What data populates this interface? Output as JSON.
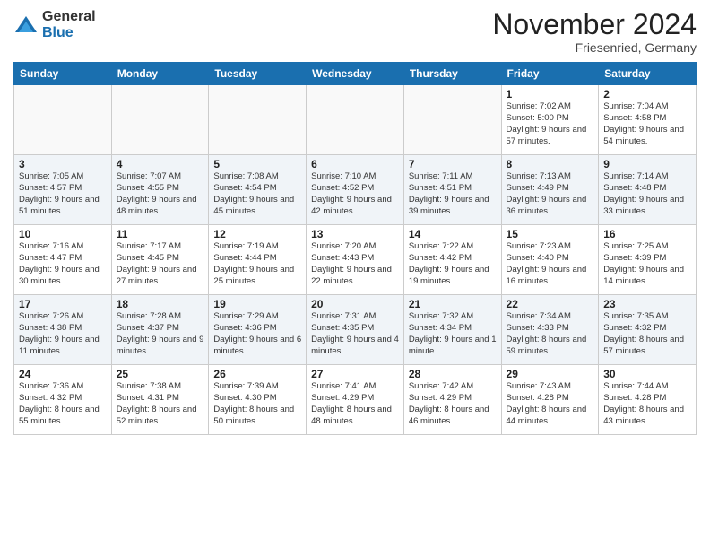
{
  "logo": {
    "general": "General",
    "blue": "Blue"
  },
  "title": "November 2024",
  "location": "Friesenried, Germany",
  "days_of_week": [
    "Sunday",
    "Monday",
    "Tuesday",
    "Wednesday",
    "Thursday",
    "Friday",
    "Saturday"
  ],
  "weeks": [
    [
      {
        "day": "",
        "info": ""
      },
      {
        "day": "",
        "info": ""
      },
      {
        "day": "",
        "info": ""
      },
      {
        "day": "",
        "info": ""
      },
      {
        "day": "",
        "info": ""
      },
      {
        "day": "1",
        "info": "Sunrise: 7:02 AM\nSunset: 5:00 PM\nDaylight: 9 hours and 57 minutes."
      },
      {
        "day": "2",
        "info": "Sunrise: 7:04 AM\nSunset: 4:58 PM\nDaylight: 9 hours and 54 minutes."
      }
    ],
    [
      {
        "day": "3",
        "info": "Sunrise: 7:05 AM\nSunset: 4:57 PM\nDaylight: 9 hours and 51 minutes."
      },
      {
        "day": "4",
        "info": "Sunrise: 7:07 AM\nSunset: 4:55 PM\nDaylight: 9 hours and 48 minutes."
      },
      {
        "day": "5",
        "info": "Sunrise: 7:08 AM\nSunset: 4:54 PM\nDaylight: 9 hours and 45 minutes."
      },
      {
        "day": "6",
        "info": "Sunrise: 7:10 AM\nSunset: 4:52 PM\nDaylight: 9 hours and 42 minutes."
      },
      {
        "day": "7",
        "info": "Sunrise: 7:11 AM\nSunset: 4:51 PM\nDaylight: 9 hours and 39 minutes."
      },
      {
        "day": "8",
        "info": "Sunrise: 7:13 AM\nSunset: 4:49 PM\nDaylight: 9 hours and 36 minutes."
      },
      {
        "day": "9",
        "info": "Sunrise: 7:14 AM\nSunset: 4:48 PM\nDaylight: 9 hours and 33 minutes."
      }
    ],
    [
      {
        "day": "10",
        "info": "Sunrise: 7:16 AM\nSunset: 4:47 PM\nDaylight: 9 hours and 30 minutes."
      },
      {
        "day": "11",
        "info": "Sunrise: 7:17 AM\nSunset: 4:45 PM\nDaylight: 9 hours and 27 minutes."
      },
      {
        "day": "12",
        "info": "Sunrise: 7:19 AM\nSunset: 4:44 PM\nDaylight: 9 hours and 25 minutes."
      },
      {
        "day": "13",
        "info": "Sunrise: 7:20 AM\nSunset: 4:43 PM\nDaylight: 9 hours and 22 minutes."
      },
      {
        "day": "14",
        "info": "Sunrise: 7:22 AM\nSunset: 4:42 PM\nDaylight: 9 hours and 19 minutes."
      },
      {
        "day": "15",
        "info": "Sunrise: 7:23 AM\nSunset: 4:40 PM\nDaylight: 9 hours and 16 minutes."
      },
      {
        "day": "16",
        "info": "Sunrise: 7:25 AM\nSunset: 4:39 PM\nDaylight: 9 hours and 14 minutes."
      }
    ],
    [
      {
        "day": "17",
        "info": "Sunrise: 7:26 AM\nSunset: 4:38 PM\nDaylight: 9 hours and 11 minutes."
      },
      {
        "day": "18",
        "info": "Sunrise: 7:28 AM\nSunset: 4:37 PM\nDaylight: 9 hours and 9 minutes."
      },
      {
        "day": "19",
        "info": "Sunrise: 7:29 AM\nSunset: 4:36 PM\nDaylight: 9 hours and 6 minutes."
      },
      {
        "day": "20",
        "info": "Sunrise: 7:31 AM\nSunset: 4:35 PM\nDaylight: 9 hours and 4 minutes."
      },
      {
        "day": "21",
        "info": "Sunrise: 7:32 AM\nSunset: 4:34 PM\nDaylight: 9 hours and 1 minute."
      },
      {
        "day": "22",
        "info": "Sunrise: 7:34 AM\nSunset: 4:33 PM\nDaylight: 8 hours and 59 minutes."
      },
      {
        "day": "23",
        "info": "Sunrise: 7:35 AM\nSunset: 4:32 PM\nDaylight: 8 hours and 57 minutes."
      }
    ],
    [
      {
        "day": "24",
        "info": "Sunrise: 7:36 AM\nSunset: 4:32 PM\nDaylight: 8 hours and 55 minutes."
      },
      {
        "day": "25",
        "info": "Sunrise: 7:38 AM\nSunset: 4:31 PM\nDaylight: 8 hours and 52 minutes."
      },
      {
        "day": "26",
        "info": "Sunrise: 7:39 AM\nSunset: 4:30 PM\nDaylight: 8 hours and 50 minutes."
      },
      {
        "day": "27",
        "info": "Sunrise: 7:41 AM\nSunset: 4:29 PM\nDaylight: 8 hours and 48 minutes."
      },
      {
        "day": "28",
        "info": "Sunrise: 7:42 AM\nSunset: 4:29 PM\nDaylight: 8 hours and 46 minutes."
      },
      {
        "day": "29",
        "info": "Sunrise: 7:43 AM\nSunset: 4:28 PM\nDaylight: 8 hours and 44 minutes."
      },
      {
        "day": "30",
        "info": "Sunrise: 7:44 AM\nSunset: 4:28 PM\nDaylight: 8 hours and 43 minutes."
      }
    ]
  ]
}
